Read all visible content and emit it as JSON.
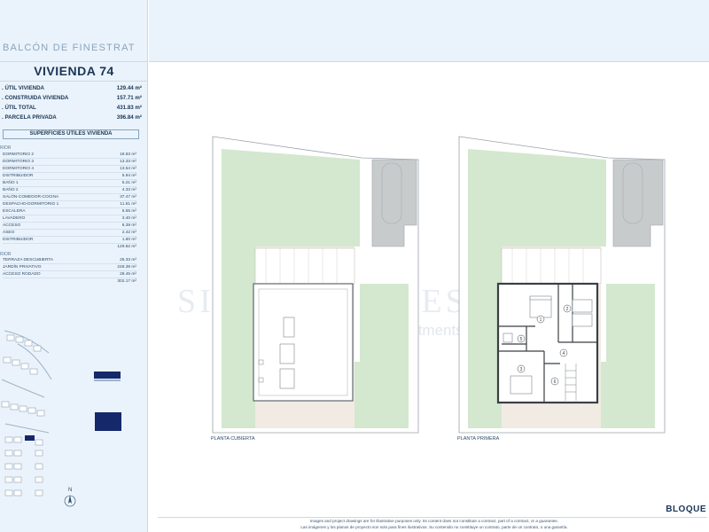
{
  "project": {
    "name": "BALCÓN DE FINESTRAT"
  },
  "unit": {
    "title": "VIVIENDA 74"
  },
  "areas": [
    {
      "label": ". ÚTIL VIVIENDA",
      "value": "129.44 m²"
    },
    {
      "label": ". CONSTRUIDA VIVIENDA",
      "value": "157.71 m²"
    },
    {
      "label": ". ÚTIL TOTAL",
      "value": "431.83 m²"
    },
    {
      "label": ". PARCELA PRIVADA",
      "value": "396.84 m²"
    }
  ],
  "surfaces": {
    "heading": "SUPERFICIES ÚTILES VIVIENDA",
    "interior_label": "RIOR",
    "interior": [
      {
        "label": "DORMITORIO 2",
        "value": "18.83 m²"
      },
      {
        "label": "DORMITORIO 3",
        "value": "13.33 m²"
      },
      {
        "label": "DORMITORIO 4",
        "value": "13.54 m²"
      },
      {
        "label": "DISTRIBUIDOR",
        "value": "5.94 m²"
      },
      {
        "label": "BAÑO 1",
        "value": "5.21 m²"
      },
      {
        "label": "BAÑO 2",
        "value": "4.33 m²"
      },
      {
        "label": "SALÓN-COMEDOR-COCINA",
        "value": "37.47 m²"
      },
      {
        "label": "DESPACHO-DORMITORIO 1",
        "value": "11.61 m²"
      },
      {
        "label": "ESCALERA",
        "value": "5.55 m²"
      },
      {
        "label": "LAVADERO",
        "value": "3.40 m²"
      },
      {
        "label": "ACCESO",
        "value": "6.39 m²"
      },
      {
        "label": "ASEO",
        "value": "2.42 m²"
      },
      {
        "label": "DISTRIBUIDOR",
        "value": "1.60 m²"
      }
    ],
    "interior_total": "129.82 m²",
    "exterior_label": "RIOR",
    "exterior": [
      {
        "label": "TERRAZA DESCUBIERTA",
        "value": "25.33 m²"
      },
      {
        "label": "JARDÍN PRIVATIVO",
        "value": "248.39 m²"
      },
      {
        "label": "ACCESO RODADO",
        "value": "28.45 m²"
      }
    ],
    "exterior_total": "302.17 m²"
  },
  "plans": [
    {
      "label": "PLANTA CUBIERTA"
    },
    {
      "label": "PLANTA PRIMERA"
    }
  ],
  "room_numbers": [
    "1",
    "2",
    "3",
    "4",
    "5",
    "6"
  ],
  "north": {
    "label": "N"
  },
  "watermark": {
    "main": "SIENNA HOMES",
    "sub": "& Investments"
  },
  "footer": {
    "disclaimer_en": "Images and project drawings are for illustrative purposes only. Its content does not constitute a contract, part of a contract, or a guarantee.",
    "disclaimer_es": "Las imágenes y los planos de proyecto son solo para fines ilustrativos. Su contenido no constituye un contrato, parte de un contrato, o una garantía.",
    "block": "BLOQUE"
  },
  "colors": {
    "garden": "#d3e8cf",
    "terrace": "#f1ebe4",
    "driveway": "#c8cbcc",
    "navy": "#14286a",
    "panel": "#eaf3fb"
  }
}
